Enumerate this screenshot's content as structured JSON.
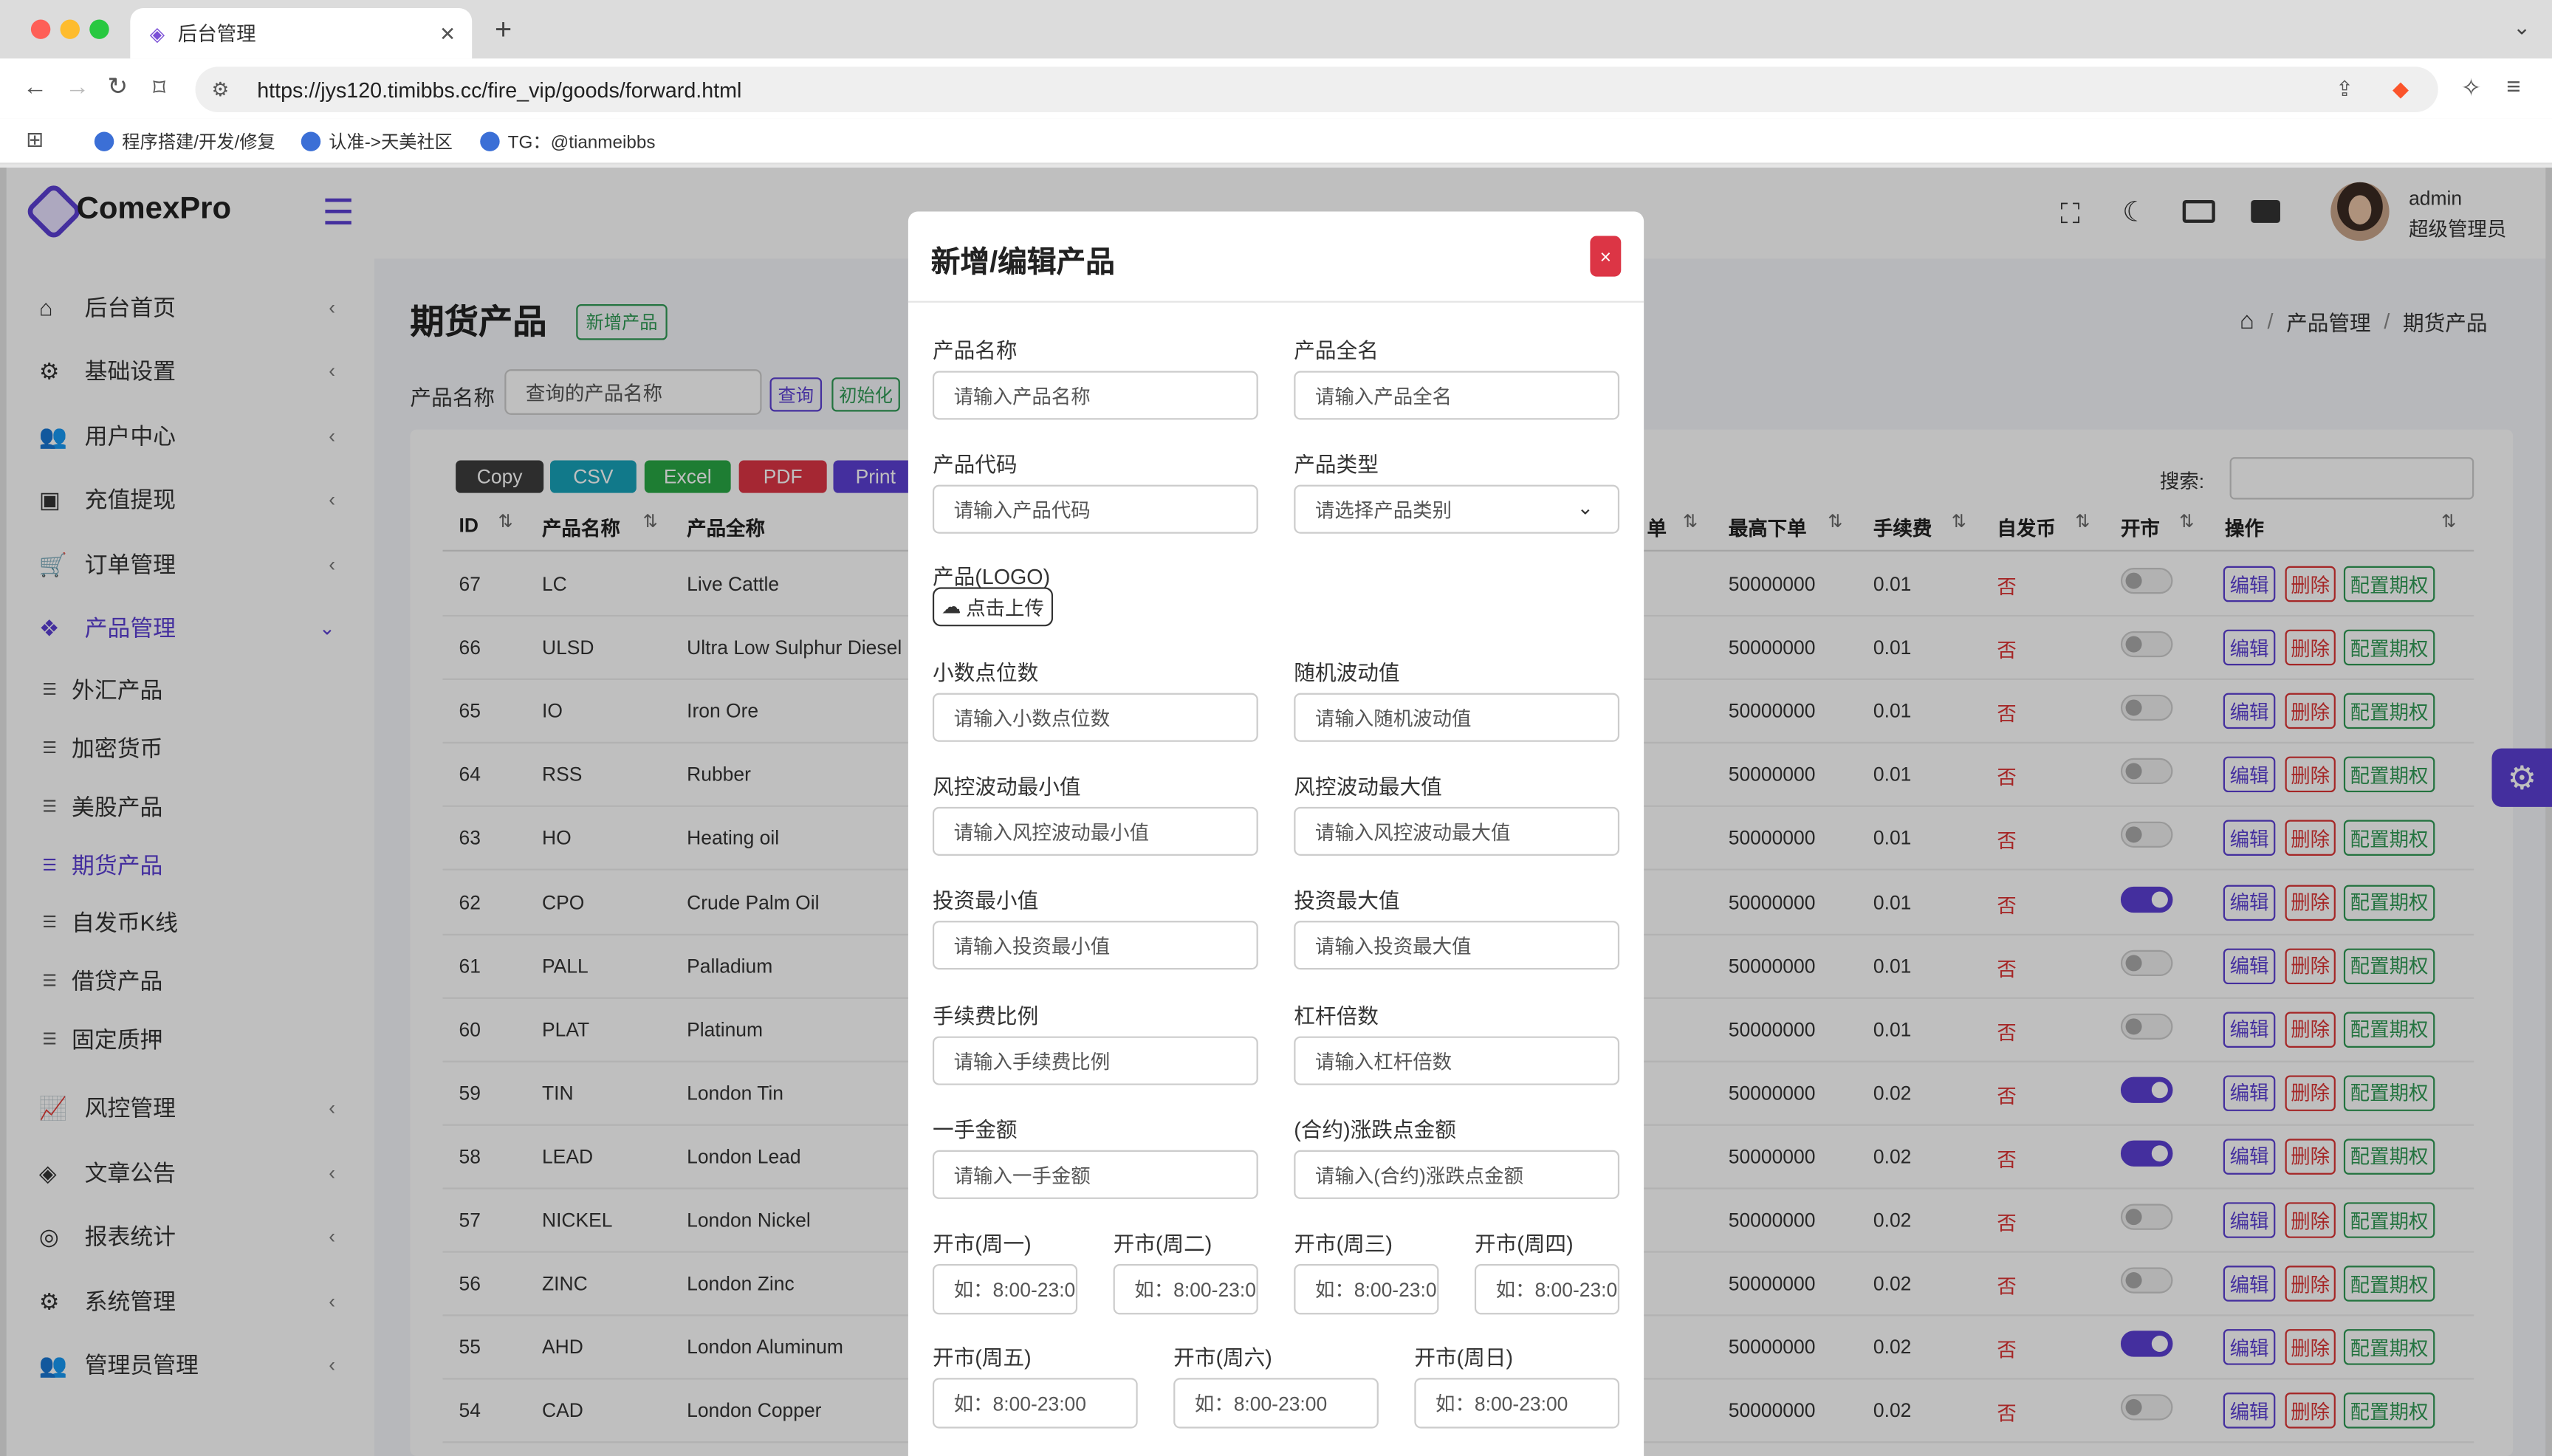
{
  "browser": {
    "tab_title": "后台管理",
    "url": "https://jys120.timibbs.cc/fire_vip/goods/forward.html",
    "bookmarks": [
      "程序搭建/开发/修复",
      "认准->天美社区",
      "TG：@tianmeibbs"
    ]
  },
  "brand": {
    "name": "ComexPro"
  },
  "user": {
    "name": "admin",
    "role": "超级管理员"
  },
  "sidebar": {
    "items": [
      {
        "label": "后台首页",
        "icon": "home-icon"
      },
      {
        "label": "基础设置",
        "icon": "cogs-icon"
      },
      {
        "label": "用户中心",
        "icon": "users-icon"
      },
      {
        "label": "充值提现",
        "icon": "money-icon"
      },
      {
        "label": "订单管理",
        "icon": "cart-icon"
      },
      {
        "label": "产品管理",
        "icon": "cubes-icon"
      }
    ],
    "subitems": [
      "外汇产品",
      "加密货币",
      "美股产品",
      "期货产品",
      "自发币K线",
      "借贷产品",
      "固定质押"
    ],
    "items_bottom": [
      {
        "label": "风控管理",
        "icon": "chart-line-icon"
      },
      {
        "label": "文章公告",
        "icon": "layers-icon"
      },
      {
        "label": "报表统计",
        "icon": "coins-icon"
      },
      {
        "label": "系统管理",
        "icon": "gear-icon"
      },
      {
        "label": "管理员管理",
        "icon": "user-group-icon"
      }
    ]
  },
  "page": {
    "title": "期货产品",
    "add_button": "新增产品",
    "breadcrumb": [
      "产品管理",
      "期货产品"
    ],
    "filter_label": "产品名称",
    "filter_placeholder": "查询的产品名称",
    "query_button": "查询",
    "init_button": "初始化",
    "search_label": "搜索:"
  },
  "export_buttons": [
    "Copy",
    "CSV",
    "Excel",
    "PDF",
    "Print"
  ],
  "table": {
    "headers": {
      "id": "ID",
      "name": "产品名称",
      "full": "产品全称",
      "min": "单",
      "max": "最高下单",
      "fee": "手续费",
      "own": "自发币",
      "open": "开市",
      "ops": "操作"
    },
    "row_buttons": {
      "edit": "编辑",
      "del": "删除",
      "opt": "配置期权"
    },
    "rows": [
      {
        "id": "67",
        "name": "LC",
        "full": "Live Cattle",
        "max": "50000000",
        "fee": "0.01",
        "own": "否",
        "open": false
      },
      {
        "id": "66",
        "name": "ULSD",
        "full": "Ultra Low Sulphur Diesel",
        "max": "50000000",
        "fee": "0.01",
        "own": "否",
        "open": false
      },
      {
        "id": "65",
        "name": "IO",
        "full": "Iron Ore",
        "max": "50000000",
        "fee": "0.01",
        "own": "否",
        "open": false
      },
      {
        "id": "64",
        "name": "RSS",
        "full": "Rubber",
        "max": "50000000",
        "fee": "0.01",
        "own": "否",
        "open": false
      },
      {
        "id": "63",
        "name": "HO",
        "full": "Heating oil",
        "max": "50000000",
        "fee": "0.01",
        "own": "否",
        "open": false
      },
      {
        "id": "62",
        "name": "CPO",
        "full": "Crude Palm Oil",
        "max": "50000000",
        "fee": "0.01",
        "own": "否",
        "open": true
      },
      {
        "id": "61",
        "name": "PALL",
        "full": "Palladium",
        "max": "50000000",
        "fee": "0.01",
        "own": "否",
        "open": false
      },
      {
        "id": "60",
        "name": "PLAT",
        "full": "Platinum",
        "max": "50000000",
        "fee": "0.01",
        "own": "否",
        "open": false
      },
      {
        "id": "59",
        "name": "TIN",
        "full": "London Tin",
        "max": "50000000",
        "fee": "0.02",
        "own": "否",
        "open": true
      },
      {
        "id": "58",
        "name": "LEAD",
        "full": "London Lead",
        "max": "50000000",
        "fee": "0.02",
        "own": "否",
        "open": true
      },
      {
        "id": "57",
        "name": "NICKEL",
        "full": "London Nickel",
        "max": "50000000",
        "fee": "0.02",
        "own": "否",
        "open": false
      },
      {
        "id": "56",
        "name": "ZINC",
        "full": "London Zinc",
        "max": "50000000",
        "fee": "0.02",
        "own": "否",
        "open": false
      },
      {
        "id": "55",
        "name": "AHD",
        "full": "London Aluminum",
        "max": "50000000",
        "fee": "0.02",
        "own": "否",
        "open": true
      },
      {
        "id": "54",
        "name": "CAD",
        "full": "London Copper",
        "max": "50000000",
        "fee": "0.02",
        "own": "否",
        "open": false
      }
    ]
  },
  "modal": {
    "title": "新增/编辑产品",
    "close": "×",
    "fields": [
      {
        "label": "产品名称",
        "placeholder": "请输入产品名称"
      },
      {
        "label": "产品全名",
        "placeholder": "请输入产品全名"
      },
      {
        "label": "产品代码",
        "placeholder": "请输入产品代码"
      },
      {
        "label": "产品类型",
        "placeholder": "请选择产品类别"
      },
      {
        "label": "小数点位数",
        "placeholder": "请输入小数点位数"
      },
      {
        "label": "随机波动值",
        "placeholder": "请输入随机波动值"
      },
      {
        "label": "风控波动最小值",
        "placeholder": "请输入风控波动最小值"
      },
      {
        "label": "风控波动最大值",
        "placeholder": "请输入风控波动最大值"
      },
      {
        "label": "投资最小值",
        "placeholder": "请输入投资最小值"
      },
      {
        "label": "投资最大值",
        "placeholder": "请输入投资最大值"
      },
      {
        "label": "手续费比例",
        "placeholder": "请输入手续费比例"
      },
      {
        "label": "杠杆倍数",
        "placeholder": "请输入杠杆倍数"
      },
      {
        "label": "一手金额",
        "placeholder": "请输入一手金额"
      },
      {
        "label": "(合约)涨跌点金额",
        "placeholder": "请输入(合约)涨跌点金额"
      }
    ],
    "logo_label": "产品(LOGO)",
    "upload_button": "点击上传",
    "days": [
      "开市(周一)",
      "开市(周二)",
      "开市(周三)",
      "开市(周四)",
      "开市(周五)",
      "开市(周六)",
      "开市(周日)"
    ],
    "day_placeholder": "如：8:00-23:00"
  },
  "colors": {
    "accent": "#5b3fd3",
    "danger": "#dc3545",
    "success": "#2f9a55"
  }
}
